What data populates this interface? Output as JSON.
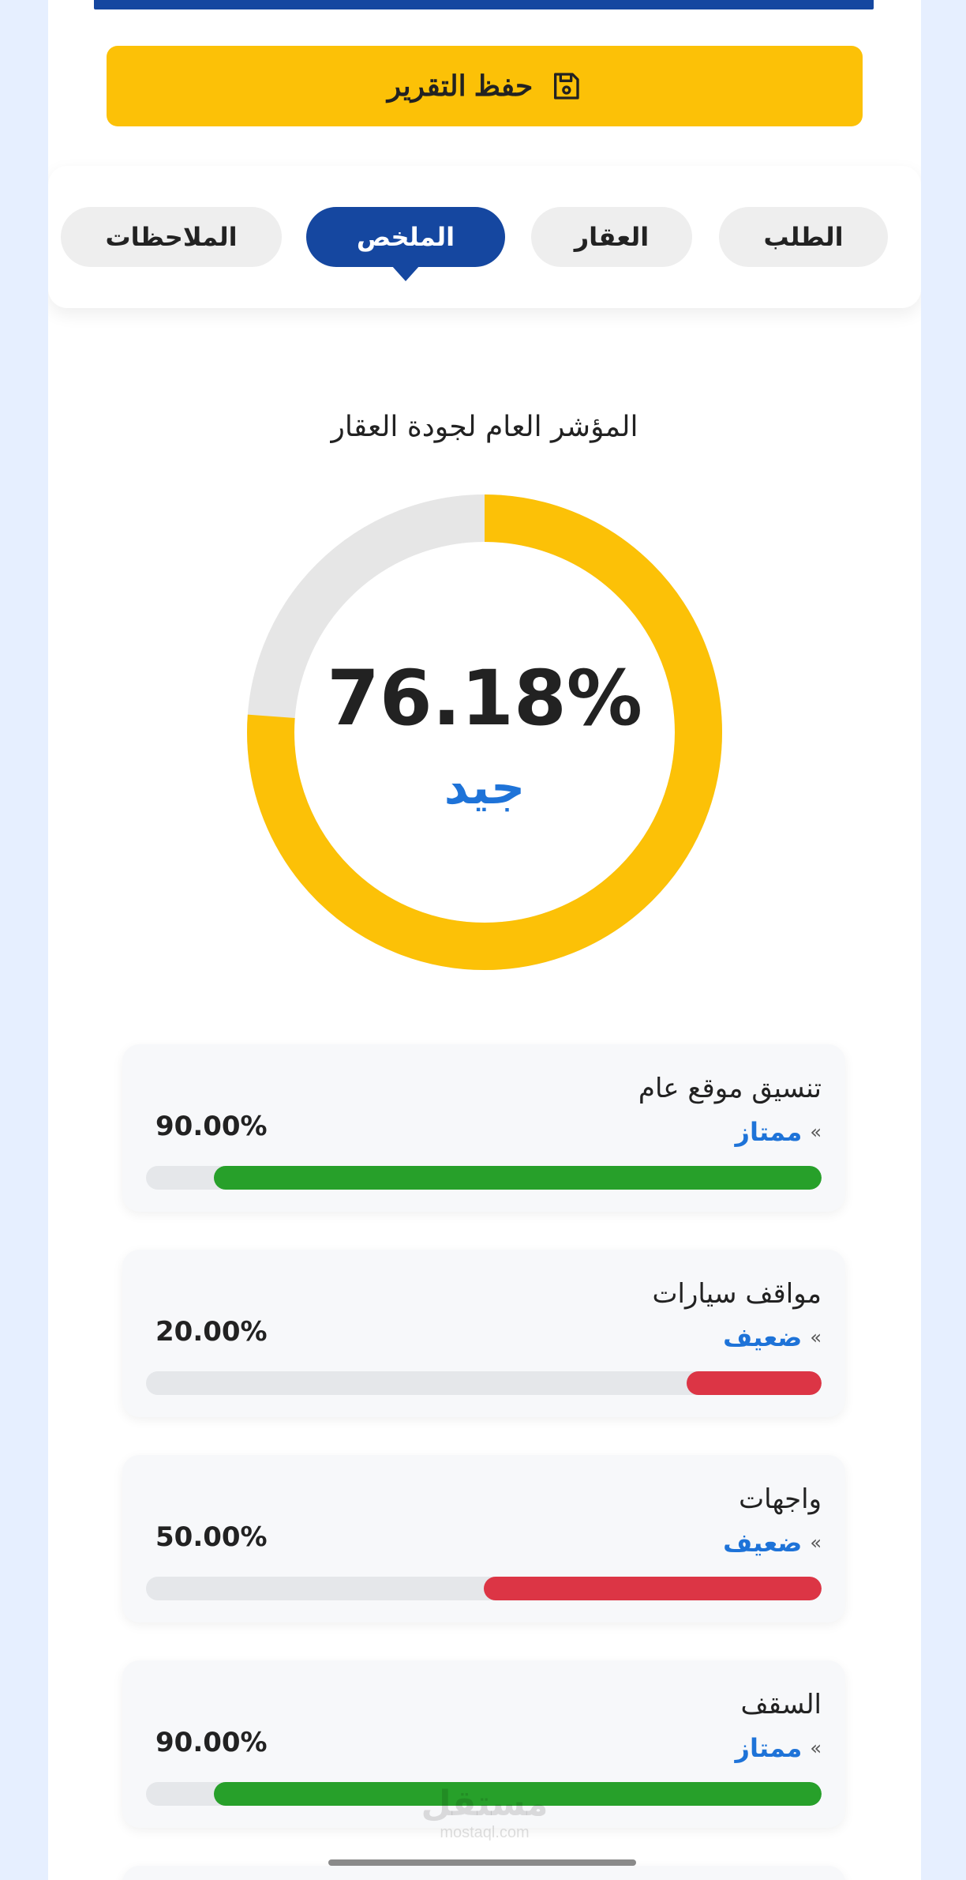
{
  "header": {
    "save_button_label": "حفظ التقرير"
  },
  "tabs": [
    {
      "label": "الطلب",
      "active": false
    },
    {
      "label": "العقار",
      "active": false
    },
    {
      "label": "الملخص",
      "active": true
    },
    {
      "label": "الملاحظات",
      "active": false
    }
  ],
  "summary": {
    "title": "المؤشر العام لجودة العقار",
    "percent_text": "76.18%",
    "percent_value": 76.18,
    "grade": "جيد"
  },
  "metrics": [
    {
      "name": "تنسيق موقع عام",
      "grade": "ممتاز",
      "percent_text": "90.00%",
      "value": 90,
      "status": "good"
    },
    {
      "name": "مواقف سيارات",
      "grade": "ضعيف",
      "percent_text": "20.00%",
      "value": 20,
      "status": "poor"
    },
    {
      "name": "واجهات",
      "grade": "ضعيف",
      "percent_text": "50.00%",
      "value": 50,
      "status": "poor"
    },
    {
      "name": "السقف",
      "grade": "ممتاز",
      "percent_text": "90.00%",
      "value": 90,
      "status": "good"
    }
  ],
  "colors": {
    "primary": "#1547a0",
    "accent": "#fcc107",
    "good": "#27a02a",
    "poor": "#dc3545",
    "grade_text": "#1e73d8",
    "track": "#e5e7ea"
  },
  "icons": {
    "save": "floppy-disk-icon",
    "grade_marker": "double-chevron-icon"
  },
  "watermark": {
    "arabic": "مستقل",
    "latin": "mostaql.com"
  }
}
